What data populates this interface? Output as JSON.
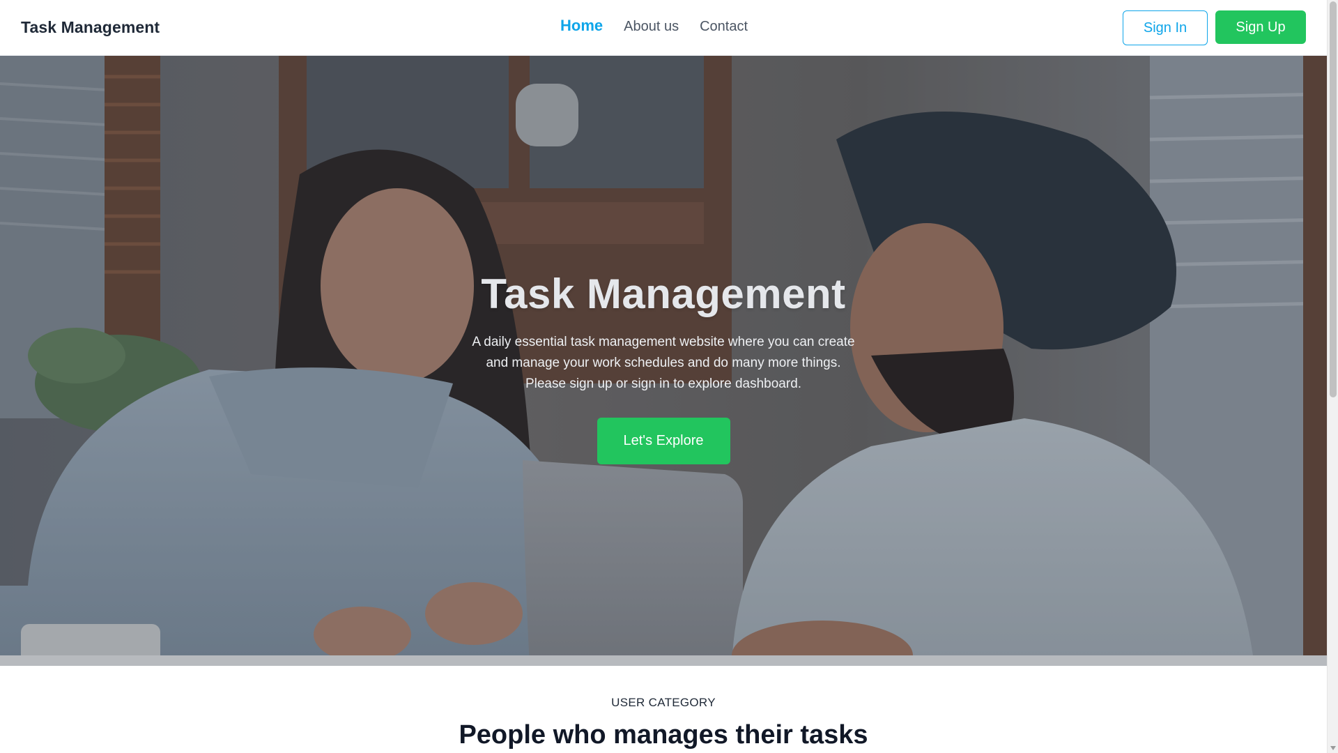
{
  "navbar": {
    "brand": "Task Management",
    "links": [
      {
        "label": "Home",
        "active": true
      },
      {
        "label": "About us",
        "active": false
      },
      {
        "label": "Contact",
        "active": false
      }
    ],
    "sign_in_label": "Sign In",
    "sign_up_label": "Sign Up"
  },
  "hero": {
    "title": "Task Management",
    "description": "A daily essential task management website where you can create and manage your work schedules and do many more things. Please sign up or sign in to explore dashboard.",
    "cta_label": "Let's Explore",
    "image": "photo of two people working at a desk with a laptop"
  },
  "section": {
    "eyebrow": "USER CATEGORY",
    "title": "People who manages their tasks"
  },
  "colors": {
    "accent": "#0ea5e9",
    "primary_button": "#22c55e",
    "text_dark": "#1f2937"
  }
}
